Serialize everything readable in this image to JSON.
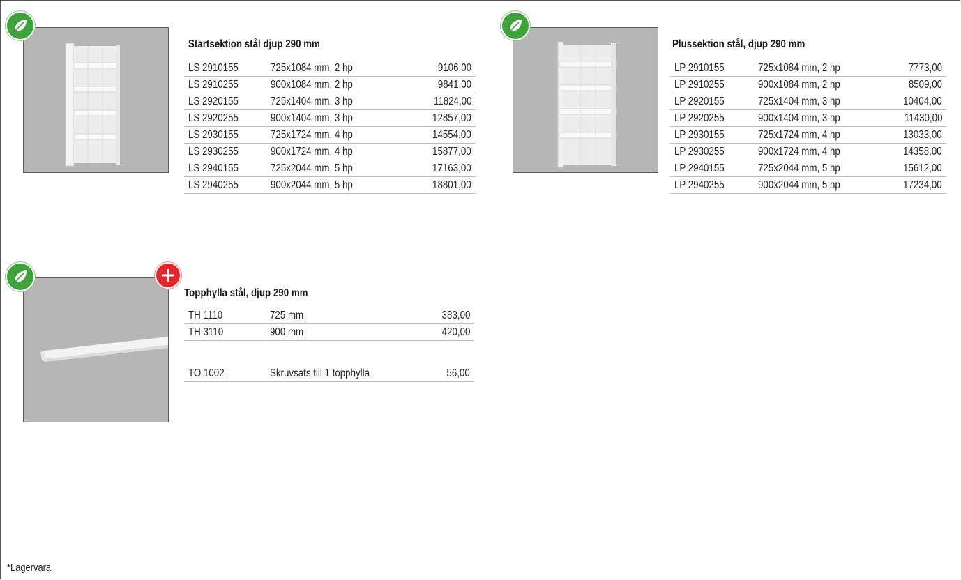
{
  "products": [
    {
      "title": "Startsektion stål djup 290 mm",
      "rows": [
        {
          "code": "LS 2910155",
          "desc": "725x1084 mm, 2 hp",
          "price": "9106,00"
        },
        {
          "code": "LS 2910255",
          "desc": "900x1084 mm, 2 hp",
          "price": "9841,00"
        },
        {
          "code": "LS 2920155",
          "desc": "725x1404 mm, 3 hp",
          "price": "11824,00"
        },
        {
          "code": "LS 2920255",
          "desc": "900x1404 mm, 3 hp",
          "price": "12857,00"
        },
        {
          "code": "LS 2930155",
          "desc": "725x1724 mm, 4 hp",
          "price": "14554,00"
        },
        {
          "code": "LS 2930255",
          "desc": "900x1724 mm, 4 hp",
          "price": "15877,00"
        },
        {
          "code": "LS 2940155",
          "desc": "725x2044 mm, 5 hp",
          "price": "17163,00"
        },
        {
          "code": "LS 2940255",
          "desc": "900x2044 mm, 5 hp",
          "price": "18801,00"
        }
      ]
    },
    {
      "title": "Plussektion stål, djup 290 mm",
      "rows": [
        {
          "code": "LP 2910155",
          "desc": "725x1084 mm, 2 hp",
          "price": "7773,00"
        },
        {
          "code": "LP 2910255",
          "desc": "900x1084 mm, 2 hp",
          "price": "8509,00"
        },
        {
          "code": "LP 2920155",
          "desc": "725x1404 mm, 3 hp",
          "price": "10404,00"
        },
        {
          "code": "LP 2920255",
          "desc": "900x1404 mm, 3 hp",
          "price": "11430,00"
        },
        {
          "code": "LP 2930155",
          "desc": "725x1724 mm, 4 hp",
          "price": "13033,00"
        },
        {
          "code": "LP 2930255",
          "desc": "900x1724 mm, 4 hp",
          "price": "14358,00"
        },
        {
          "code": "LP 2940155",
          "desc": "725x2044 mm, 5 hp",
          "price": "15612,00"
        },
        {
          "code": "LP 2940255",
          "desc": "900x2044 mm, 5 hp",
          "price": "17234,00"
        }
      ]
    },
    {
      "title": "Topphylla stål, djup 290 mm",
      "rows": [
        {
          "code": "TH 1110",
          "desc": "725 mm",
          "price": "383,00"
        },
        {
          "code": "TH 3110",
          "desc": "900 mm",
          "price": "420,00"
        },
        {
          "code": "",
          "desc": "",
          "price": ""
        },
        {
          "code": "TO 1002",
          "desc": "Skruvsats till 1 topphylla",
          "price": "56,00"
        }
      ]
    }
  ],
  "badges": {
    "eco_icon": "leaf-icon",
    "plus_icon": "plus-icon",
    "eco_color": "#3ea33a",
    "plus_color": "#e3262b"
  },
  "footnote": "*Lagervara"
}
